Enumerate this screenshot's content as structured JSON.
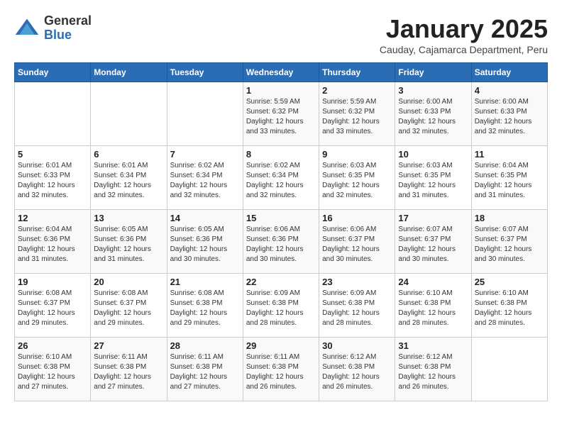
{
  "header": {
    "logo_general": "General",
    "logo_blue": "Blue",
    "month_title": "January 2025",
    "location": "Cauday, Cajamarca Department, Peru"
  },
  "weekdays": [
    "Sunday",
    "Monday",
    "Tuesday",
    "Wednesday",
    "Thursday",
    "Friday",
    "Saturday"
  ],
  "weeks": [
    [
      {
        "day": "",
        "sunrise": "",
        "sunset": "",
        "daylight": ""
      },
      {
        "day": "",
        "sunrise": "",
        "sunset": "",
        "daylight": ""
      },
      {
        "day": "",
        "sunrise": "",
        "sunset": "",
        "daylight": ""
      },
      {
        "day": "1",
        "sunrise": "Sunrise: 5:59 AM",
        "sunset": "Sunset: 6:32 PM",
        "daylight": "Daylight: 12 hours and 33 minutes."
      },
      {
        "day": "2",
        "sunrise": "Sunrise: 5:59 AM",
        "sunset": "Sunset: 6:32 PM",
        "daylight": "Daylight: 12 hours and 33 minutes."
      },
      {
        "day": "3",
        "sunrise": "Sunrise: 6:00 AM",
        "sunset": "Sunset: 6:33 PM",
        "daylight": "Daylight: 12 hours and 32 minutes."
      },
      {
        "day": "4",
        "sunrise": "Sunrise: 6:00 AM",
        "sunset": "Sunset: 6:33 PM",
        "daylight": "Daylight: 12 hours and 32 minutes."
      }
    ],
    [
      {
        "day": "5",
        "sunrise": "Sunrise: 6:01 AM",
        "sunset": "Sunset: 6:33 PM",
        "daylight": "Daylight: 12 hours and 32 minutes."
      },
      {
        "day": "6",
        "sunrise": "Sunrise: 6:01 AM",
        "sunset": "Sunset: 6:34 PM",
        "daylight": "Daylight: 12 hours and 32 minutes."
      },
      {
        "day": "7",
        "sunrise": "Sunrise: 6:02 AM",
        "sunset": "Sunset: 6:34 PM",
        "daylight": "Daylight: 12 hours and 32 minutes."
      },
      {
        "day": "8",
        "sunrise": "Sunrise: 6:02 AM",
        "sunset": "Sunset: 6:34 PM",
        "daylight": "Daylight: 12 hours and 32 minutes."
      },
      {
        "day": "9",
        "sunrise": "Sunrise: 6:03 AM",
        "sunset": "Sunset: 6:35 PM",
        "daylight": "Daylight: 12 hours and 32 minutes."
      },
      {
        "day": "10",
        "sunrise": "Sunrise: 6:03 AM",
        "sunset": "Sunset: 6:35 PM",
        "daylight": "Daylight: 12 hours and 31 minutes."
      },
      {
        "day": "11",
        "sunrise": "Sunrise: 6:04 AM",
        "sunset": "Sunset: 6:35 PM",
        "daylight": "Daylight: 12 hours and 31 minutes."
      }
    ],
    [
      {
        "day": "12",
        "sunrise": "Sunrise: 6:04 AM",
        "sunset": "Sunset: 6:36 PM",
        "daylight": "Daylight: 12 hours and 31 minutes."
      },
      {
        "day": "13",
        "sunrise": "Sunrise: 6:05 AM",
        "sunset": "Sunset: 6:36 PM",
        "daylight": "Daylight: 12 hours and 31 minutes."
      },
      {
        "day": "14",
        "sunrise": "Sunrise: 6:05 AM",
        "sunset": "Sunset: 6:36 PM",
        "daylight": "Daylight: 12 hours and 30 minutes."
      },
      {
        "day": "15",
        "sunrise": "Sunrise: 6:06 AM",
        "sunset": "Sunset: 6:36 PM",
        "daylight": "Daylight: 12 hours and 30 minutes."
      },
      {
        "day": "16",
        "sunrise": "Sunrise: 6:06 AM",
        "sunset": "Sunset: 6:37 PM",
        "daylight": "Daylight: 12 hours and 30 minutes."
      },
      {
        "day": "17",
        "sunrise": "Sunrise: 6:07 AM",
        "sunset": "Sunset: 6:37 PM",
        "daylight": "Daylight: 12 hours and 30 minutes."
      },
      {
        "day": "18",
        "sunrise": "Sunrise: 6:07 AM",
        "sunset": "Sunset: 6:37 PM",
        "daylight": "Daylight: 12 hours and 30 minutes."
      }
    ],
    [
      {
        "day": "19",
        "sunrise": "Sunrise: 6:08 AM",
        "sunset": "Sunset: 6:37 PM",
        "daylight": "Daylight: 12 hours and 29 minutes."
      },
      {
        "day": "20",
        "sunrise": "Sunrise: 6:08 AM",
        "sunset": "Sunset: 6:37 PM",
        "daylight": "Daylight: 12 hours and 29 minutes."
      },
      {
        "day": "21",
        "sunrise": "Sunrise: 6:08 AM",
        "sunset": "Sunset: 6:38 PM",
        "daylight": "Daylight: 12 hours and 29 minutes."
      },
      {
        "day": "22",
        "sunrise": "Sunrise: 6:09 AM",
        "sunset": "Sunset: 6:38 PM",
        "daylight": "Daylight: 12 hours and 28 minutes."
      },
      {
        "day": "23",
        "sunrise": "Sunrise: 6:09 AM",
        "sunset": "Sunset: 6:38 PM",
        "daylight": "Daylight: 12 hours and 28 minutes."
      },
      {
        "day": "24",
        "sunrise": "Sunrise: 6:10 AM",
        "sunset": "Sunset: 6:38 PM",
        "daylight": "Daylight: 12 hours and 28 minutes."
      },
      {
        "day": "25",
        "sunrise": "Sunrise: 6:10 AM",
        "sunset": "Sunset: 6:38 PM",
        "daylight": "Daylight: 12 hours and 28 minutes."
      }
    ],
    [
      {
        "day": "26",
        "sunrise": "Sunrise: 6:10 AM",
        "sunset": "Sunset: 6:38 PM",
        "daylight": "Daylight: 12 hours and 27 minutes."
      },
      {
        "day": "27",
        "sunrise": "Sunrise: 6:11 AM",
        "sunset": "Sunset: 6:38 PM",
        "daylight": "Daylight: 12 hours and 27 minutes."
      },
      {
        "day": "28",
        "sunrise": "Sunrise: 6:11 AM",
        "sunset": "Sunset: 6:38 PM",
        "daylight": "Daylight: 12 hours and 27 minutes."
      },
      {
        "day": "29",
        "sunrise": "Sunrise: 6:11 AM",
        "sunset": "Sunset: 6:38 PM",
        "daylight": "Daylight: 12 hours and 26 minutes."
      },
      {
        "day": "30",
        "sunrise": "Sunrise: 6:12 AM",
        "sunset": "Sunset: 6:38 PM",
        "daylight": "Daylight: 12 hours and 26 minutes."
      },
      {
        "day": "31",
        "sunrise": "Sunrise: 6:12 AM",
        "sunset": "Sunset: 6:38 PM",
        "daylight": "Daylight: 12 hours and 26 minutes."
      },
      {
        "day": "",
        "sunrise": "",
        "sunset": "",
        "daylight": ""
      }
    ]
  ]
}
